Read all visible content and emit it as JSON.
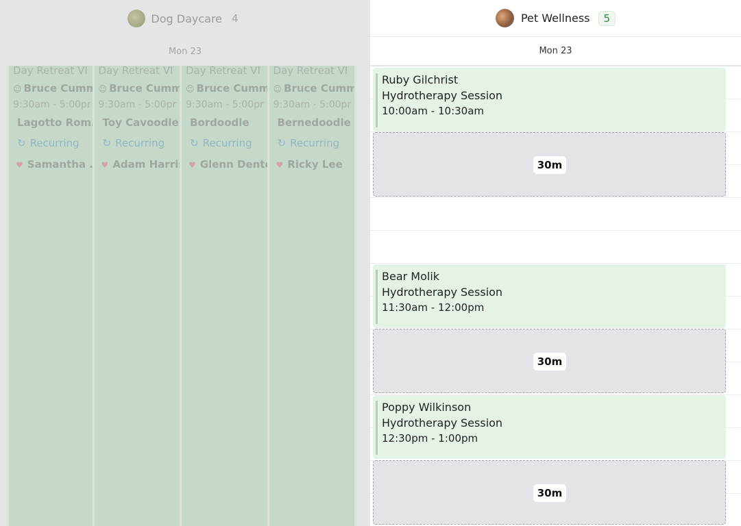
{
  "left_panel": {
    "title": "Dog Daycare",
    "count": "4",
    "date": "Mon 23",
    "columns": [
      {
        "title": "Day Retreat VI",
        "staff": "Bruce Cumm",
        "time": "9:30am - 5:00pr",
        "breed": "Lagotto Rom…",
        "recurring": "Recurring",
        "owner": "Samantha …"
      },
      {
        "title": "Day Retreat VI",
        "staff": "Bruce Cumm",
        "time": "9:30am - 5:00pr",
        "breed": "Toy Cavoodle",
        "recurring": "Recurring",
        "owner": "Adam Harris"
      },
      {
        "title": "Day Retreat VI",
        "staff": "Bruce Cumm",
        "time": "9:30am - 5:00pr",
        "breed": "Bordoodle",
        "recurring": "Recurring",
        "owner": "Glenn Dento"
      },
      {
        "title": "Day Retreat VI",
        "staff": "Bruce Cumm",
        "time": "9:30am - 5:00pr",
        "breed": "Bernedoodle",
        "recurring": "Recurring",
        "owner": "Ricky Lee"
      }
    ]
  },
  "right_panel": {
    "title": "Pet Wellness",
    "count": "5",
    "date": "Mon 23",
    "appointments": [
      {
        "name": "Ruby Gilchrist",
        "service": "Hydrotherapy Session",
        "time": "10:00am - 10:30am",
        "gap": "30m"
      },
      {
        "name": "Bear Molik",
        "service": "Hydrotherapy Session",
        "time": "11:30am - 12:00pm",
        "gap": "30m"
      },
      {
        "name": "Poppy Wilkinson",
        "service": "Hydrotherapy Session",
        "time": "12:30pm - 1:00pm",
        "gap": "30m"
      }
    ]
  },
  "icons": {
    "staff": "person-circle-icon",
    "recurring": "recurring-icon",
    "owner": "heart-icon"
  }
}
